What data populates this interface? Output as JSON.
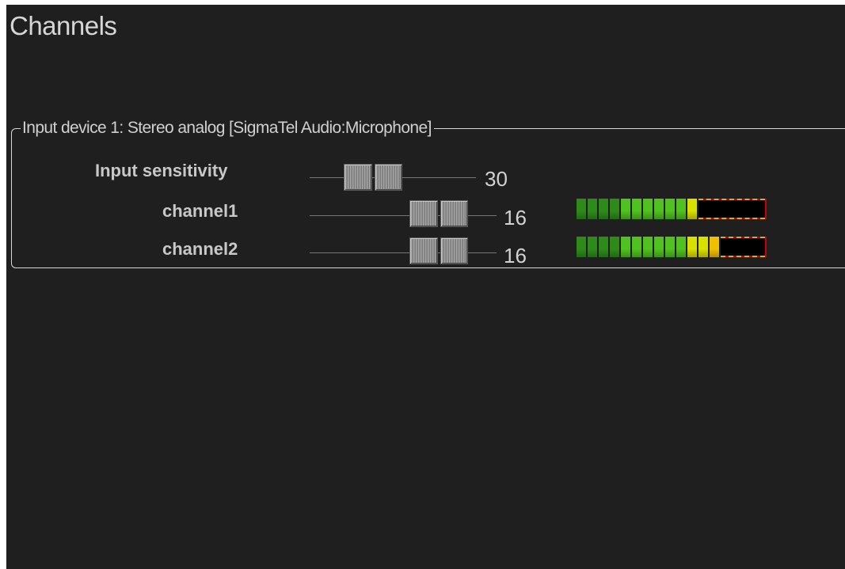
{
  "header": {
    "title": "Channels"
  },
  "group": {
    "legend": "Input device 1: Stereo analog [SigmaTel Audio:Microphone]"
  },
  "rows": [
    {
      "label": "Input sensitivity",
      "value": "30",
      "slider_level": 0.3
    },
    {
      "label": "channel1",
      "value": "16",
      "slider_level": 0.64,
      "meter_level": 0.62
    },
    {
      "label": "channel2",
      "value": "16",
      "slider_level": 0.64,
      "meter_level": 0.75
    }
  ],
  "colors": {
    "background": "#1f1f1f",
    "meter_low": "#2e8b1a",
    "meter_mid": "#4fc21f",
    "meter_high": "#d8e000",
    "meter_peak": "#f0c000",
    "meter_border": "#cc0000"
  }
}
